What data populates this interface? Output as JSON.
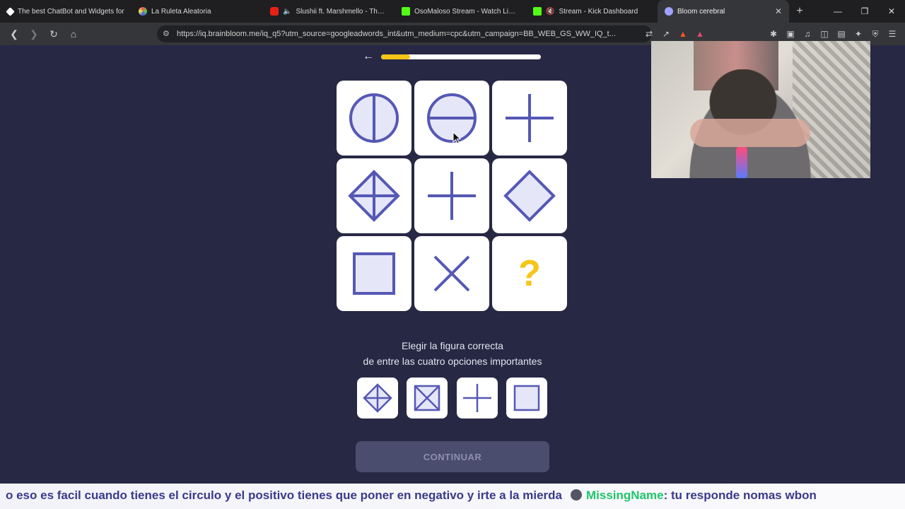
{
  "browser": {
    "tabs": [
      {
        "title": "The best ChatBot and Widgets for",
        "favicon_color": "#ffffff"
      },
      {
        "title": "La Ruleta Aleatoria",
        "favicon_color": "#a37bd8"
      },
      {
        "title": "Slushii ft. Marshmello - There",
        "favicon_color": "#e62117"
      },
      {
        "title": "OsoMaloso Stream - Watch Live o",
        "favicon_color": "#53fc18"
      },
      {
        "title": "Stream - Kick Dashboard",
        "favicon_color": "#53fc18"
      },
      {
        "title": "Bloom cerebral",
        "favicon_color": "#9fa3ff",
        "active": true
      }
    ],
    "url": "https://iq.brainbloom.me/iq_q5?utm_source=googleadwords_int&utm_medium=cpc&utm_campaign=BB_WEB_GS_WW_IQ_t..."
  },
  "quiz": {
    "progress": 0.18,
    "question_mark": "?",
    "grid_cells": [
      {
        "shape": "circle-vertical-line-icon"
      },
      {
        "shape": "circle-horizontal-line-icon"
      },
      {
        "shape": "plus-icon"
      },
      {
        "shape": "diamond-plus-icon"
      },
      {
        "shape": "plus-icon"
      },
      {
        "shape": "diamond-icon"
      },
      {
        "shape": "square-icon"
      },
      {
        "shape": "x-icon"
      },
      {
        "shape": "question-mark"
      }
    ],
    "instruction_line1": "Elegir la figura correcta",
    "instruction_line2": "de entre las cuatro opciones importantes",
    "options": [
      {
        "shape": "diamond-plus-icon"
      },
      {
        "shape": "square-x-icon"
      },
      {
        "shape": "plus-icon"
      },
      {
        "shape": "square-icon"
      }
    ],
    "continue_label": "CONTINUAR"
  },
  "chat": {
    "message_text": "o eso es facil cuando tienes el circulo y el positivo tienes que poner en negativo y irte a la mierda",
    "username": "MissingName",
    "reply_text": ": tu responde nomas wbon"
  },
  "colors": {
    "background": "#262844",
    "shape_stroke": "#5558b4",
    "shape_fill": "#e5e6f7",
    "accent_yellow": "#f5c518"
  }
}
